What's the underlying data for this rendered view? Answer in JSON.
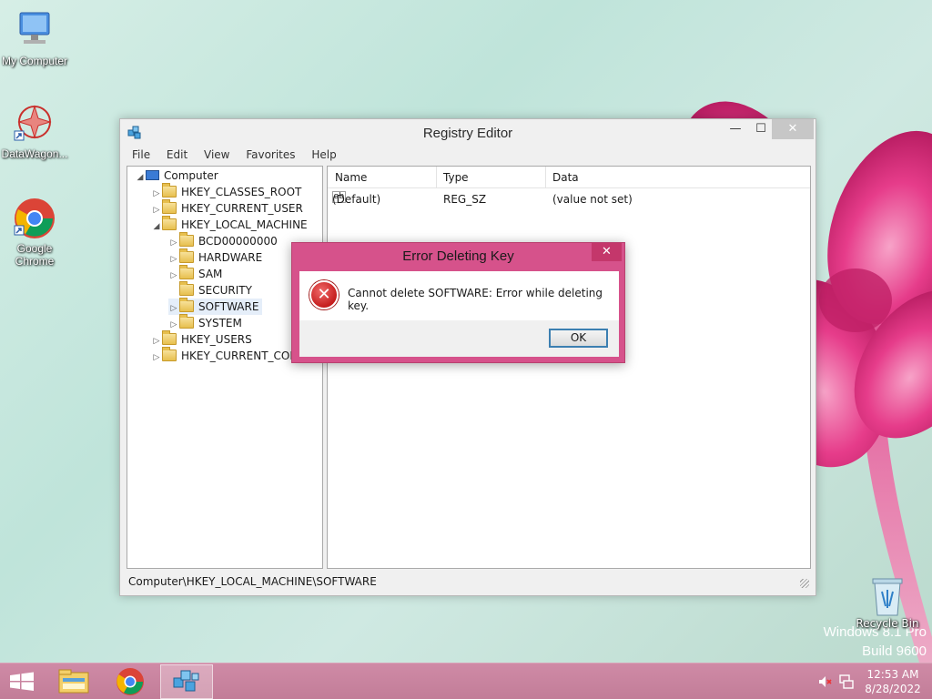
{
  "desktop": {
    "icons": [
      {
        "label": "My Computer"
      },
      {
        "label": "DataWagon..."
      },
      {
        "label": "Google Chrome"
      }
    ],
    "recycle_bin_label": "Recycle Bin",
    "watermark_line1": "Windows 8.1 Pro",
    "watermark_line2": "Build 9600"
  },
  "window": {
    "title": "Registry Editor",
    "minimize": "—",
    "maximize": "☐",
    "close": "✕",
    "menu": [
      "File",
      "Edit",
      "View",
      "Favorites",
      "Help"
    ],
    "tree": [
      {
        "label": "Computer",
        "expander": "◢"
      },
      {
        "label": "HKEY_CLASSES_ROOT",
        "expander": "▷"
      },
      {
        "label": "HKEY_CURRENT_USER",
        "expander": "▷"
      },
      {
        "label": "HKEY_LOCAL_MACHINE",
        "expander": "◢"
      },
      {
        "label": "BCD00000000",
        "expander": "▷"
      },
      {
        "label": "HARDWARE",
        "expander": "▷"
      },
      {
        "label": "SAM",
        "expander": "▷"
      },
      {
        "label": "SECURITY",
        "expander": ""
      },
      {
        "label": "SOFTWARE",
        "expander": "▷"
      },
      {
        "label": "SYSTEM",
        "expander": "▷"
      },
      {
        "label": "HKEY_USERS",
        "expander": "▷"
      },
      {
        "label": "HKEY_CURRENT_CONFIG",
        "expander": "▷"
      }
    ],
    "columns": [
      "Name",
      "Type",
      "Data"
    ],
    "values": [
      {
        "name": "(Default)",
        "type": "REG_SZ",
        "data": "(value not set)",
        "icon": "ab"
      }
    ],
    "status_path": "Computer\\HKEY_LOCAL_MACHINE\\SOFTWARE"
  },
  "dialog": {
    "title": "Error Deleting Key",
    "close": "✕",
    "icon": "✕",
    "message": "Cannot delete SOFTWARE:  Error while deleting key.",
    "ok_label": "OK"
  },
  "taskbar": {
    "clock_time": "12:53 AM",
    "clock_date": "8/28/2022"
  },
  "colors": {
    "taskbar": "#c8839e",
    "dialog_frame": "#d6528b",
    "accent_flower": "#e23d87"
  }
}
